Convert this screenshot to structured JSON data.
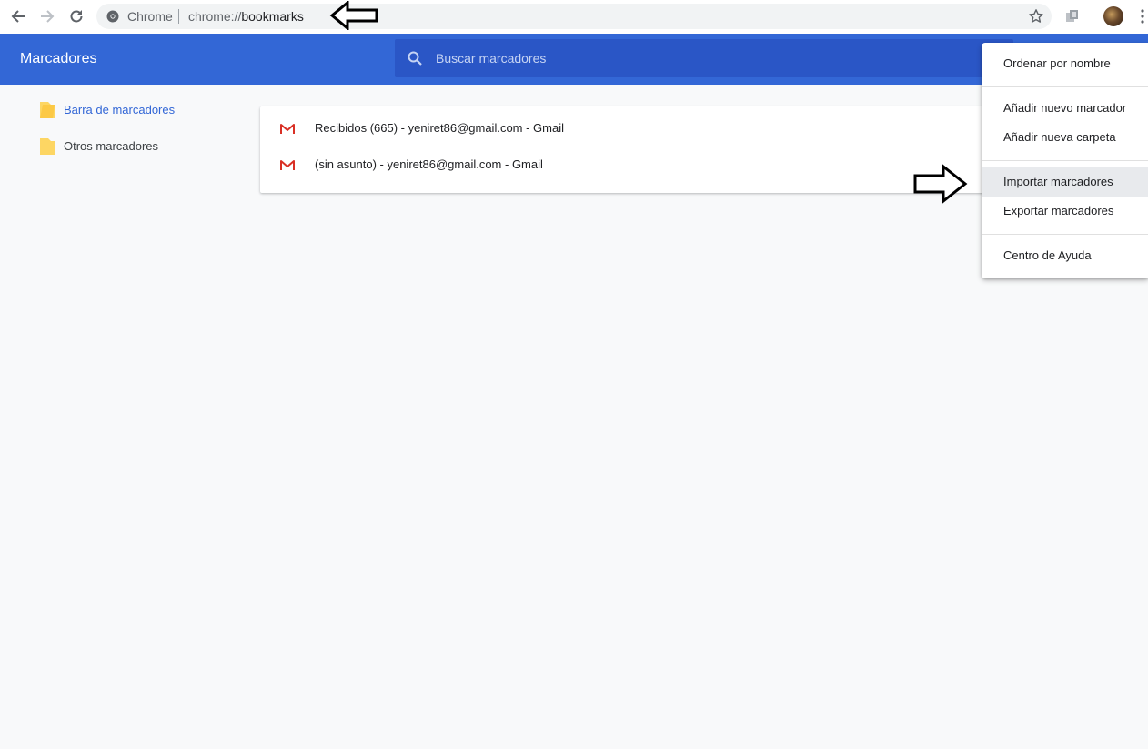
{
  "browser": {
    "site_name": "Chrome",
    "url_scheme": "chrome://",
    "url_host": "bookmarks"
  },
  "header": {
    "title": "Marcadores",
    "search_placeholder": "Buscar marcadores"
  },
  "sidebar": {
    "items": [
      {
        "label": "Barra de marcadores",
        "selected": true,
        "color": "#3367d6"
      },
      {
        "label": "Otros marcadores",
        "selected": false,
        "color": "#3c4043"
      }
    ]
  },
  "bookmarks": [
    {
      "title": "Recibidos (665) - yeniret86@gmail.com - Gmail",
      "icon": "gmail-icon"
    },
    {
      "title": "(sin asunto) - yeniret86@gmail.com - Gmail",
      "icon": "gmail-icon"
    }
  ],
  "menu": {
    "items": [
      {
        "label": "Ordenar por nombre"
      },
      {
        "label": "Añadir nuevo marcador"
      },
      {
        "label": "Añadir nueva carpeta"
      },
      {
        "label": "Importar marcadores",
        "hovered": true
      },
      {
        "label": "Exportar marcadores"
      },
      {
        "label": "Centro de Ayuda"
      }
    ]
  },
  "colors": {
    "header_blue": "#3367d6",
    "search_blue": "#2a56c6",
    "background": "#f8f9fa",
    "folder_yellow": "#fdd663",
    "gmail_red": "#d93025"
  }
}
